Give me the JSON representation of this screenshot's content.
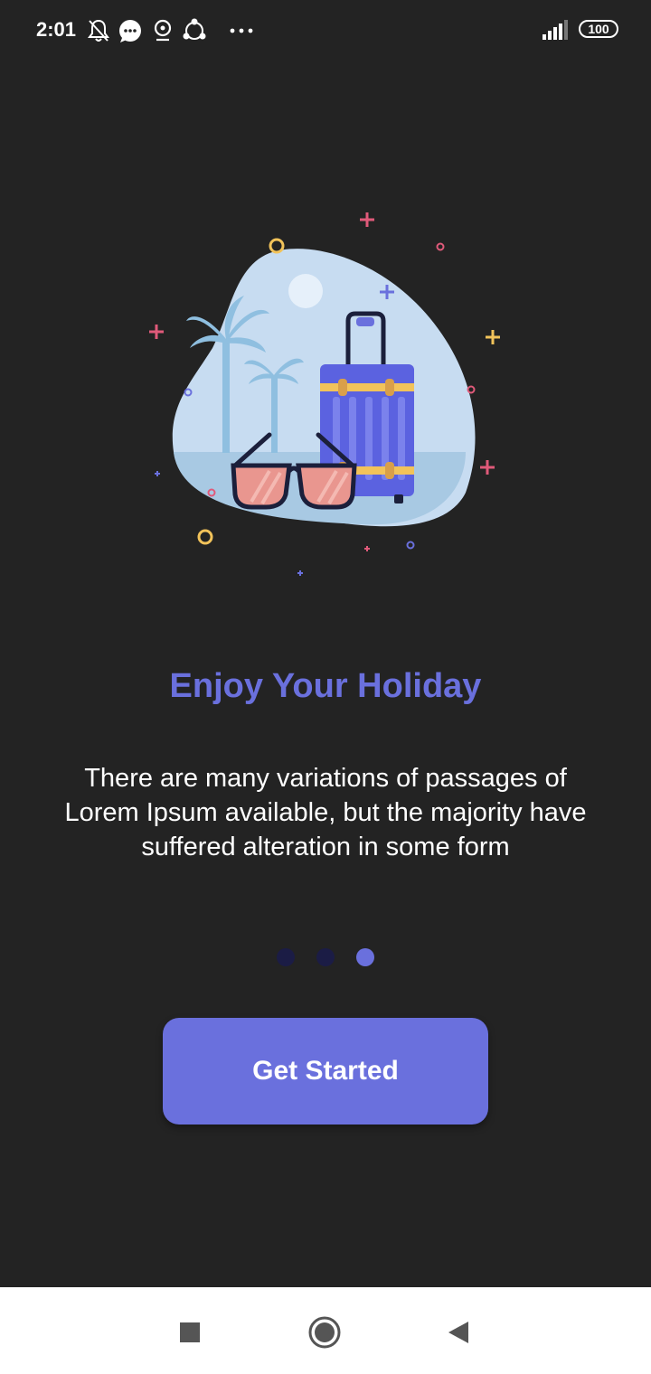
{
  "status_bar": {
    "time": "2:01",
    "battery": "100",
    "icons": [
      "bell-off-icon",
      "chat-icon",
      "location-icon",
      "share-icon",
      "more-icon",
      "signal-icon",
      "battery-icon"
    ]
  },
  "onboarding": {
    "illustration": "holiday-suitcase-sunglasses-illustration",
    "title": "Enjoy Your Holiday",
    "description": "There are many variations of passages of Lorem Ipsum available, but the majority have suffered alteration in some form",
    "page_indicator": {
      "total": 3,
      "active": 3
    },
    "cta_label": "Get Started"
  },
  "nav_bar": {
    "buttons": [
      "recents-square-icon",
      "home-circle-icon",
      "back-triangle-icon"
    ]
  },
  "colors": {
    "background": "#232323",
    "accent": "#6a70dd",
    "dot_inactive": "#1b1c45"
  }
}
